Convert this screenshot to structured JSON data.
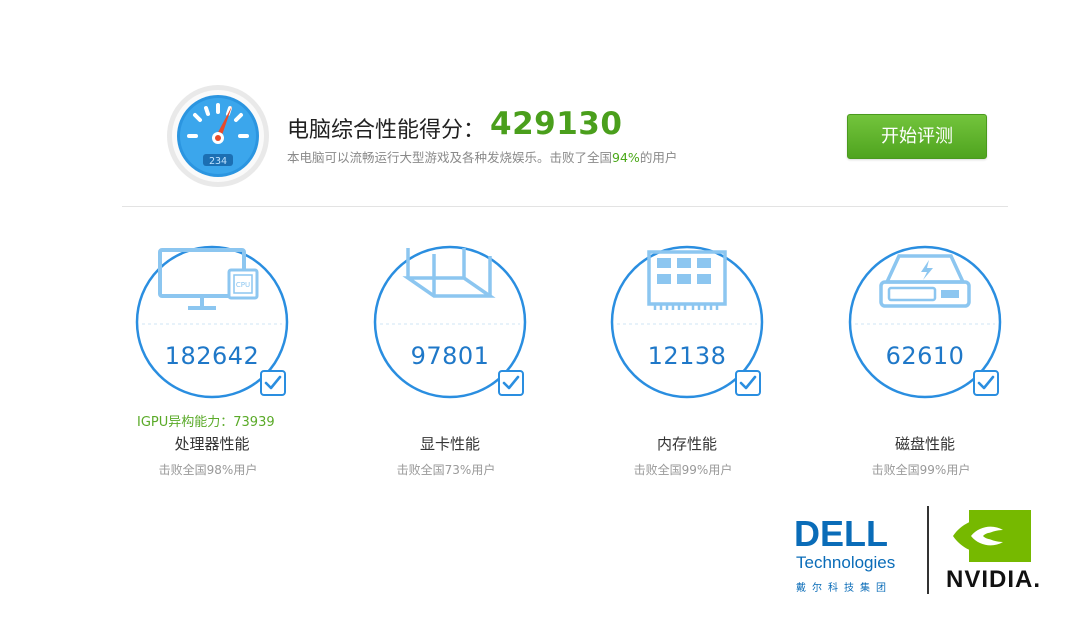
{
  "header": {
    "title": "电脑综合性能得分：",
    "score": "429130",
    "subtitle_prefix": "本电脑可以流畅运行大型游戏及各种发烧娱乐。击败了全国",
    "subtitle_pct": "94%",
    "subtitle_suffix": "的用户",
    "gauge_readout": "234",
    "start_button": "开始评测"
  },
  "components": [
    {
      "name": "处理器性能",
      "score": "182642",
      "beat": "击败全国98%用户",
      "icon": "monitor-cpu-icon",
      "extra": "IGPU异构能力：73939"
    },
    {
      "name": "显卡性能",
      "score": "97801",
      "beat": "击败全国73%用户",
      "icon": "gpu-box-icon"
    },
    {
      "name": "内存性能",
      "score": "12138",
      "beat": "击败全国99%用户",
      "icon": "memory-chip-icon"
    },
    {
      "name": "磁盘性能",
      "score": "62610",
      "beat": "击败全国99%用户",
      "icon": "disk-drive-icon"
    }
  ],
  "logos": {
    "dell_word": "DELL",
    "dell_sub": "Technologies",
    "dell_cn": "戴尔科技集团",
    "nvidia_word": "NVIDIA."
  },
  "colors": {
    "accent_green": "#4a9f1c",
    "circle_blue": "#2a8ee0",
    "score_blue": "#1f78c8",
    "dell_blue": "#0a6cb8",
    "nvidia_green": "#76b900"
  }
}
